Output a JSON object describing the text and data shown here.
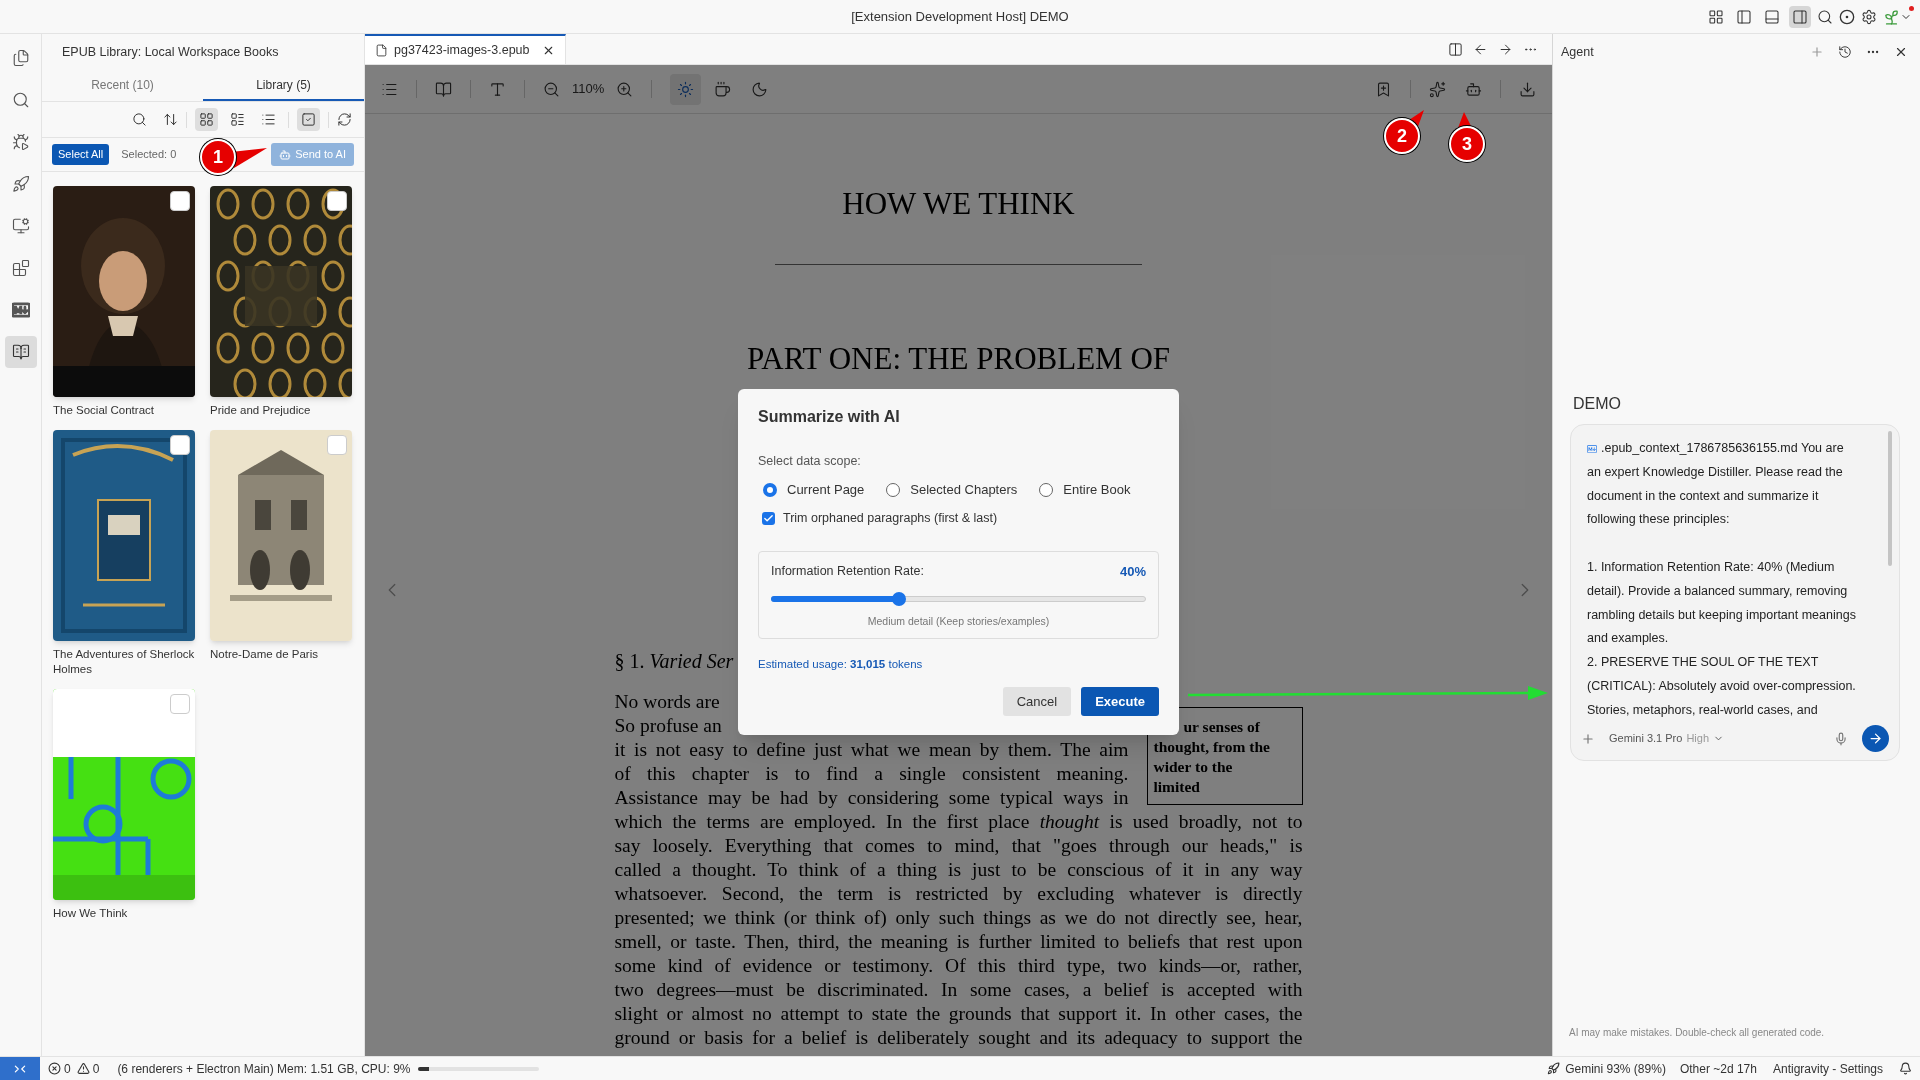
{
  "window": {
    "title": "[Extension Development Host] DEMO",
    "layout_toggles": [
      {
        "kind": "grid",
        "selected": false
      },
      {
        "kind": "left",
        "selected": false
      },
      {
        "kind": "bottom",
        "selected": false
      },
      {
        "kind": "right",
        "selected": true
      }
    ]
  },
  "activity_bar": [
    {
      "kind": "explorer",
      "selected": false
    },
    {
      "kind": "search",
      "selected": false
    },
    {
      "kind": "debug",
      "selected": false
    },
    {
      "kind": "deploy",
      "selected": false
    },
    {
      "kind": "remote",
      "selected": false
    },
    {
      "kind": "extensions",
      "selected": false
    },
    {
      "kind": "markdown",
      "selected": false
    },
    {
      "kind": "library",
      "selected": true
    }
  ],
  "sidebar": {
    "title": "EPUB Library: Local Workspace Books",
    "tabs": [
      {
        "label": "Recent (10)",
        "selected": false
      },
      {
        "label": "Library (5)",
        "selected": true
      }
    ],
    "view_modes": [
      {
        "kind": "grid",
        "selected": true
      },
      {
        "kind": "cards",
        "selected": false
      },
      {
        "kind": "list",
        "selected": false
      }
    ],
    "select_mode": {
      "on": true
    },
    "select_all": "Select All",
    "selected_count": "Selected: 0",
    "send_button": {
      "label": "Send to AI",
      "disabled": true
    },
    "books": [
      {
        "title": "The Social Contract",
        "checked": false,
        "kind": "portrait"
      },
      {
        "title": "Pride and Prejudice",
        "checked": false,
        "kind": "ornate"
      },
      {
        "title": "The Adventures of Sherlock Holmes",
        "checked": false,
        "kind": "cloth"
      },
      {
        "title": "Notre-Dame de Paris",
        "checked": false,
        "kind": "engraving"
      },
      {
        "title": "How We Think",
        "checked": false,
        "kind": "graphic"
      }
    ]
  },
  "editor": {
    "tab": "pg37423-images-3.epub",
    "zoom": "110%",
    "themes": [
      {
        "kind": "light",
        "selected": true
      },
      {
        "kind": "sepia",
        "selected": false
      },
      {
        "kind": "dark",
        "selected": false
      }
    ],
    "page": {
      "title": "HOW WE THINK",
      "part": "PART ONE: THE PROBLEM OF",
      "section": "§ 1. *Varied Ser*",
      "lines_beside": [
        "No words are",
        "So profuse an",
        "it is not easy to define just what we mean by them. The aim",
        "of this chapter is to find a single consistent meaning.",
        "Assistance may be had by considering some typical ways in"
      ],
      "aside": "ur senses of\nthought, from the\nwider to the\nlimited",
      "lines": [
        "which the terms are employed. In the first place *thought* is used broadly, not to",
        "say loosely. Everything that comes to mind, that \"goes through our heads,\" is",
        "called a thought. To think of a thing is just to be conscious of it in any way",
        "whatsoever. Second, the term is restricted by excluding whatever is directly",
        "presented; we think (or think of) only such things as we do not directly see, hear,",
        "smell, or taste. Then, third, the meaning is further limited to beliefs that rest upon",
        "some kind of evidence or testimony. Of this third type, two kinds—or, rather,",
        "two degrees—must be discriminated. In some cases, a belief is accepted with",
        "slight or almost no attempt to state the grounds that support it. In other cases, the",
        "ground or basis for a belief is deliberately sought and its adequacy to support the"
      ]
    }
  },
  "dialog": {
    "title": "Summarize with AI",
    "scope_label": "Select data scope:",
    "scopes": [
      {
        "label": "Current Page",
        "selected": true
      },
      {
        "label": "Selected Chapters",
        "selected": false
      },
      {
        "label": "Entire Book",
        "selected": false
      }
    ],
    "trim": {
      "label": "Trim orphaned paragraphs (first & last)",
      "checked": true
    },
    "retention": {
      "label": "Information Retention Rate:",
      "value": "40%",
      "level": 0.34,
      "caption": "Medium detail (Keep stories/examples)"
    },
    "usage": "Estimated usage: **31,015** tokens",
    "buttons": [
      {
        "label": "Cancel",
        "kind": "secondary"
      },
      {
        "label": "Execute",
        "kind": "primary"
      }
    ]
  },
  "agent": {
    "title": "Agent",
    "conversation": "DEMO",
    "context_file": ".epub_context_1786785636155.md",
    "message": "You are\nan expert Knowledge Distiller. Please read the\ndocument in the context and summarize it\nfollowing these principles:\n\n1. Information Retention Rate: 40% (Medium\ndetail). Provide a balanced summary, removing\nrambling details but keeping important meanings\nand examples.\n2. PRESERVE THE SOUL OF THE TEXT\n(CRITICAL): Absolutely avoid over-compression.\nStories, metaphors, real-world cases, and",
    "model": "Gemini 3.1 Pro",
    "effort": "High",
    "disclaimer": "AI may make mistakes. Double-check all generated code."
  },
  "status_bar": {
    "errors": "0",
    "warnings": "0",
    "process": "(6 renderers + Electron Main) Mem: 1.51 GB, CPU: 9%",
    "cpu": {
      "level": 0.09
    },
    "quota": "Gemini 93% (89%)",
    "other": "Other ~2d 17h",
    "settings": "Antigravity - Settings"
  },
  "callouts": [
    "1",
    "2",
    "3"
  ]
}
